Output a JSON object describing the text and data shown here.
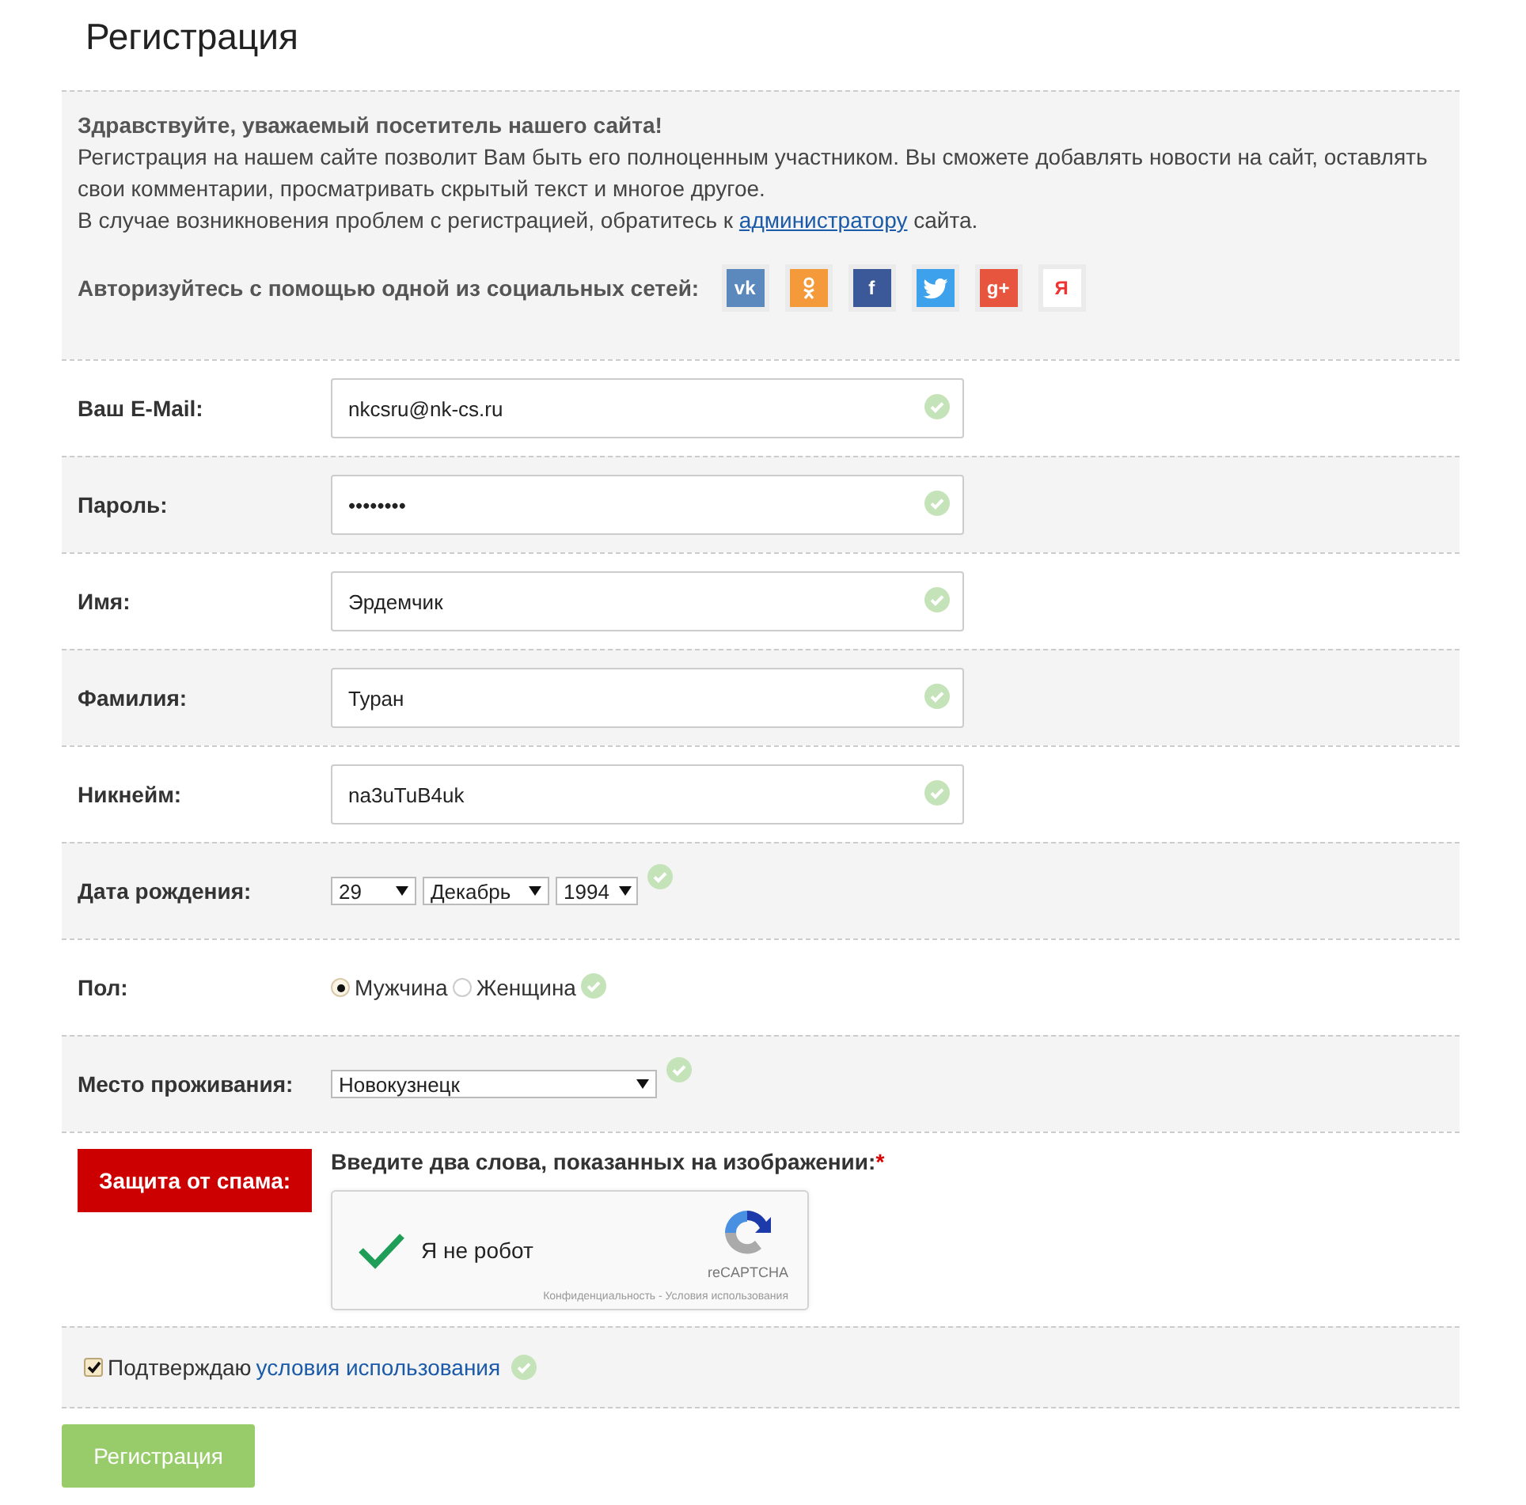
{
  "title": "Регистрация",
  "intro": {
    "greeting": "Здравствуйте, уважаемый посетитель нашего сайта!",
    "text": "Регистрация на нашем сайте позволит Вам быть его полноценным участником. Вы сможете добавлять новости на сайт, оставлять свои комментарии, просматривать скрытый текст и многое другое.",
    "help_before": "В случае возникновения проблем с регистрацией, обратитесь к",
    "help_link": "администратору",
    "help_after": "сайта.",
    "social_label": "Авторизуйтесь с помощью одной из социальных сетей:",
    "socials": [
      {
        "kind": "vk",
        "label": "vk",
        "color": "#5b88bd"
      },
      {
        "kind": "ok",
        "color": "#f59a3a"
      },
      {
        "kind": "facebook",
        "label": "f",
        "color": "#3b5998"
      },
      {
        "kind": "twitter",
        "color": "#3ea1ec"
      },
      {
        "kind": "gplus",
        "label": "g+",
        "color": "#e8553e"
      },
      {
        "kind": "yandex",
        "label": "Я",
        "color": "#ffffff"
      }
    ]
  },
  "fields": [
    {
      "kind": "text",
      "label": "Ваш E-Mail:",
      "value": "nkcsru@nk-cs.ru",
      "valid": true
    },
    {
      "kind": "text",
      "label": "Пароль:",
      "value": "••••••••",
      "valid": true
    },
    {
      "kind": "text",
      "label": "Имя:",
      "value": "Эрдемчик",
      "valid": true
    },
    {
      "kind": "text",
      "label": "Фамилия:",
      "value": "Туран",
      "valid": true
    },
    {
      "kind": "text",
      "label": "Никнейм:",
      "value": "na3uTuB4uk",
      "valid": true
    },
    {
      "kind": "date",
      "label": "Дата рождения:",
      "selects": [
        "29",
        "Декабрь",
        "1994"
      ],
      "valid": true
    },
    {
      "kind": "radio",
      "label": "Пол:",
      "options": [
        {
          "label": "Мужчина",
          "selected": true
        },
        {
          "label": "Женщина",
          "selected": false
        }
      ],
      "valid": true
    },
    {
      "kind": "select",
      "label": "Место проживания:",
      "value": "Новокузнецк",
      "valid": true
    }
  ],
  "spam": {
    "label": "Защита от спама:",
    "prompt": "Введите два слова, показанных на изображении:",
    "required_mark": "*",
    "captcha": {
      "checked": true,
      "text": "Я не робот",
      "brand": "reCAPTCHA",
      "footer": "Конфиденциальность - Условия использования"
    }
  },
  "agree": {
    "checked": true,
    "text": "Подтверждаю",
    "link": "условия использования",
    "valid": true
  },
  "submit": "Регистрация"
}
